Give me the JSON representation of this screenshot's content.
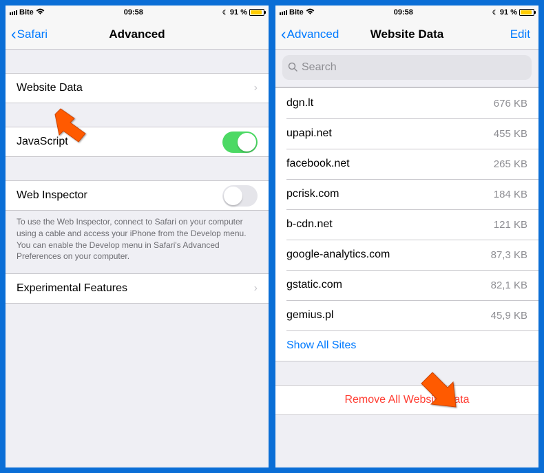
{
  "left": {
    "status": {
      "carrier": "Bite",
      "time": "09:58",
      "battery": "91 %"
    },
    "nav": {
      "back": "Safari",
      "title": "Advanced"
    },
    "rows": {
      "website_data": "Website Data",
      "javascript": "JavaScript",
      "web_inspector": "Web Inspector",
      "experimental": "Experimental Features"
    },
    "footer": "To use the Web Inspector, connect to Safari on your computer using a cable and access your iPhone from the Develop menu. You can enable the Develop menu in Safari's Advanced Preferences on your computer."
  },
  "right": {
    "status": {
      "carrier": "Bite",
      "time": "09:58",
      "battery": "91 %"
    },
    "nav": {
      "back": "Advanced",
      "title": "Website Data",
      "edit": "Edit"
    },
    "search_placeholder": "Search",
    "sites": [
      {
        "domain": "dgn.lt",
        "size": "676 KB"
      },
      {
        "domain": "upapi.net",
        "size": "455 KB"
      },
      {
        "domain": "facebook.net",
        "size": "265 KB"
      },
      {
        "domain": "pcrisk.com",
        "size": "184 KB"
      },
      {
        "domain": "b-cdn.net",
        "size": "121 KB"
      },
      {
        "domain": "google-analytics.com",
        "size": "87,3 KB"
      },
      {
        "domain": "gstatic.com",
        "size": "82,1 KB"
      },
      {
        "domain": "gemius.pl",
        "size": "45,9 KB"
      }
    ],
    "show_all": "Show All Sites",
    "remove_all": "Remove All Website Data"
  }
}
